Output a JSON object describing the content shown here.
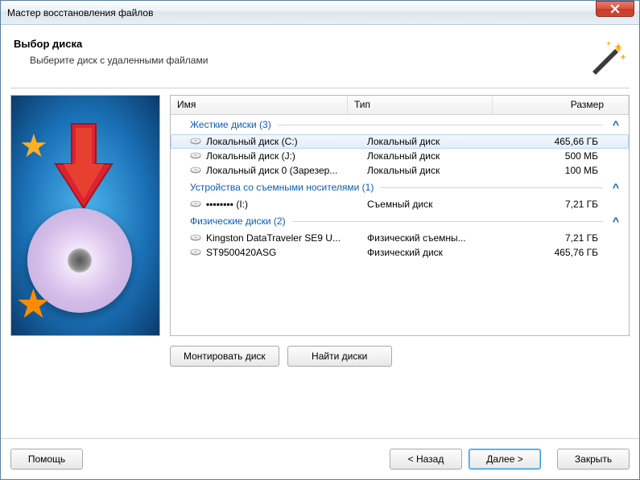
{
  "window": {
    "title": "Мастер восстановления файлов"
  },
  "header": {
    "title": "Выбор диска",
    "subtitle": "Выберите диск с удаленными файлами"
  },
  "columns": {
    "name": "Имя",
    "type": "Тип",
    "size": "Размер"
  },
  "groups": [
    {
      "label": "Жесткие диски (3)",
      "items": [
        {
          "name": "Локальный диск (C:)",
          "type": "Локальный диск",
          "size": "465,66 ГБ",
          "selected": true
        },
        {
          "name": "Локальный диск (J:)",
          "type": "Локальный диск",
          "size": "500 МБ",
          "selected": false
        },
        {
          "name": "Локальный диск 0 (Зарезер...",
          "type": "Локальный диск",
          "size": "100 МБ",
          "selected": false
        }
      ]
    },
    {
      "label": "Устройства со съемными носителями (1)",
      "items": [
        {
          "name": "▪▪▪▪▪▪▪▪ (I:)",
          "type": "Съемный диск",
          "size": "7,21 ГБ",
          "selected": false
        }
      ]
    },
    {
      "label": "Физические диски (2)",
      "items": [
        {
          "name": "Kingston DataTraveler SE9 U...",
          "type": "Физический съемны...",
          "size": "7,21 ГБ",
          "selected": false
        },
        {
          "name": "ST9500420ASG",
          "type": "Физический диск",
          "size": "465,76 ГБ",
          "selected": false
        }
      ]
    }
  ],
  "buttons": {
    "mount": "Монтировать диск",
    "find": "Найти диски",
    "help": "Помощь",
    "back": "< Назад",
    "next": "Далее >",
    "close": "Закрыть"
  }
}
